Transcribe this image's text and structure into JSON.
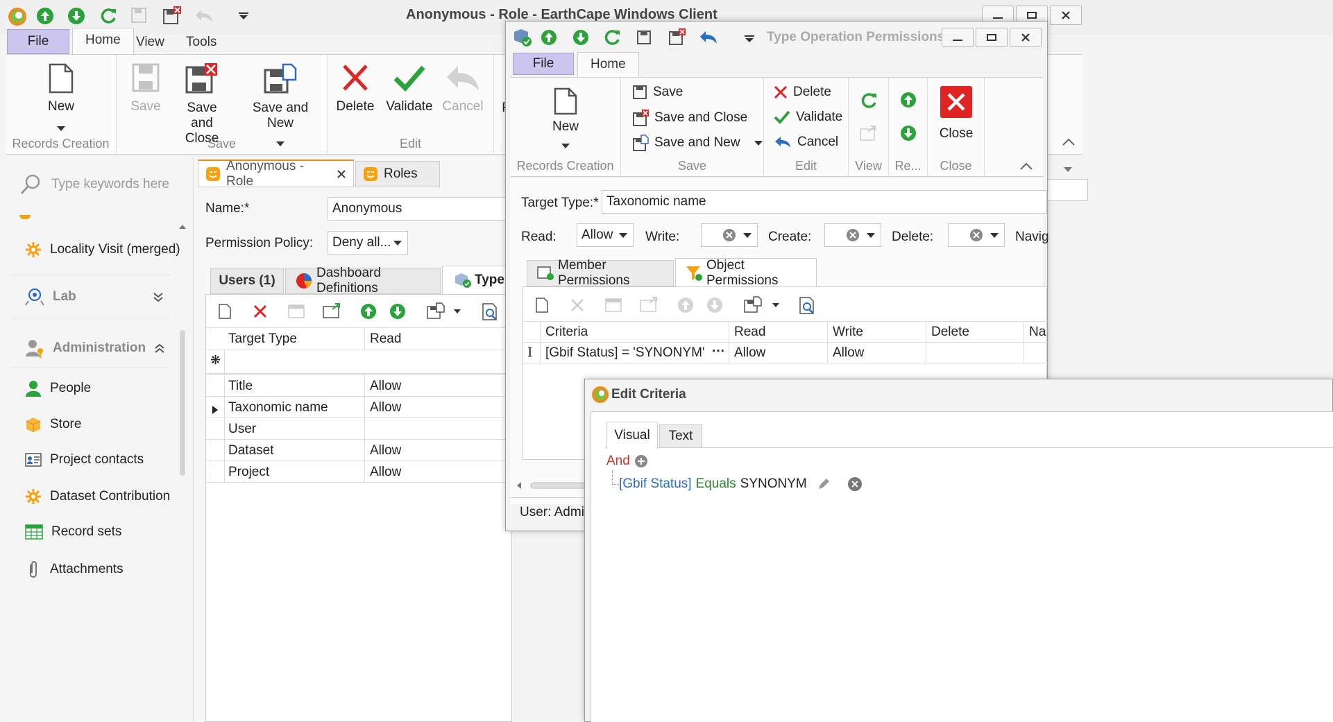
{
  "main": {
    "title": "Anonymous - Role - EarthCape Windows Client",
    "tabs": [
      "File",
      "Home",
      "View",
      "Tools"
    ],
    "ribbon": {
      "new": "New",
      "save": "Save",
      "save_close": "Save and Close",
      "save_new": "Save and New",
      "delete": "Delete",
      "validate": "Validate",
      "cancel": "Cancel",
      "partial": "F",
      "groups": [
        "Records Creation",
        "Save",
        "Edit"
      ]
    },
    "search_placeholder": "Type keywords here",
    "sidebar": {
      "locality_visit": "Locality Visit (merged)",
      "lab": "Lab",
      "administration": "Administration",
      "items": [
        "People",
        "Store",
        "Project contacts",
        "Dataset Contribution",
        "Record sets",
        "Attachments"
      ]
    },
    "doc_tabs": [
      "Anonymous - Role",
      "Roles"
    ],
    "form": {
      "name_label": "Name:*",
      "name_value": "Anonymous",
      "policy_label": "Permission Policy:",
      "policy_value": "Deny all..."
    },
    "sub_tabs": [
      "Users (1)",
      "Dashboard Definitions",
      "Type"
    ],
    "grid": {
      "headers": [
        "Target Type",
        "Read"
      ],
      "rows": [
        {
          "type": "Title",
          "read": "Allow"
        },
        {
          "type": "Taxonomic name",
          "read": "Allow"
        },
        {
          "type": "User",
          "read": ""
        },
        {
          "type": "Dataset",
          "read": "Allow"
        },
        {
          "type": "Project",
          "read": "Allow"
        }
      ]
    }
  },
  "top": {
    "title": "Type Operation Permissions",
    "tabs": [
      "File",
      "Home"
    ],
    "ribbon": {
      "new": "New",
      "save": "Save",
      "save_close": "Save and Close",
      "save_new": "Save and New",
      "delete": "Delete",
      "validate": "Validate",
      "cancel": "Cancel",
      "close": "Close",
      "groups": [
        "Records Creation",
        "Save",
        "Edit",
        "View",
        "Re...",
        "Close"
      ]
    },
    "target_label": "Target Type:*",
    "target_value": "Taxonomic name",
    "read_label": "Read:",
    "read_value": "Allow",
    "write_label": "Write:",
    "create_label": "Create:",
    "delete_label": "Delete:",
    "navig_label": "Navig",
    "perm_tabs": [
      "Member Permissions",
      "Object Permissions"
    ],
    "grid_headers": [
      "Criteria",
      "Read",
      "Write",
      "Delete",
      "Na"
    ],
    "grid_row": {
      "criteria": "[Gbif Status] = 'SYNONYM'",
      "ellipsis": "···",
      "read": "Allow",
      "write": "Allow"
    },
    "status": "User: Admin"
  },
  "criteria": {
    "title": "Edit Criteria",
    "tabs": [
      "Visual",
      "Text"
    ],
    "and": "And",
    "field": "[Gbif Status]",
    "op": "Equals",
    "value": "SYNONYM"
  },
  "colors": {
    "green": "#2aa33b",
    "red": "#e02424",
    "blue": "#2b6cc4",
    "file_tab": "#ccc6ee"
  }
}
